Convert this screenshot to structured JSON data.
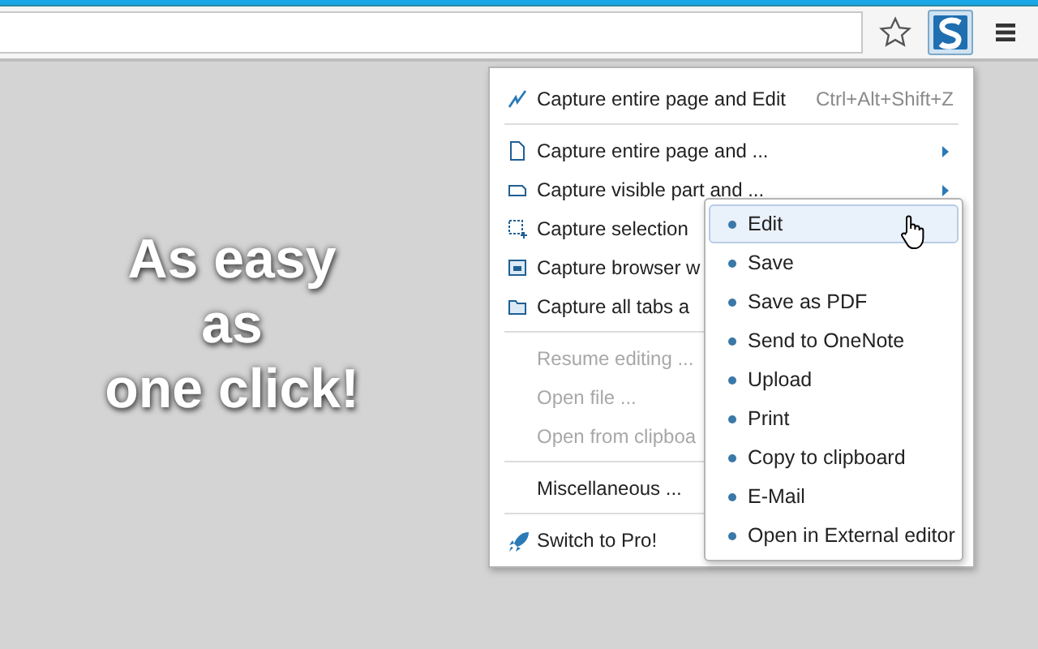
{
  "toolbar": {
    "bookmark_starred": false,
    "extension_active": true
  },
  "headline": {
    "lines": [
      "As easy",
      "as",
      "one click!"
    ]
  },
  "menu": {
    "groups": [
      [
        {
          "kind": "command",
          "label": "Capture entire page and Edit",
          "shortcut": "Ctrl+Alt+Shift+Z",
          "disabled": false
        }
      ],
      [
        {
          "kind": "submenu",
          "label": "Capture entire page and ...",
          "disabled": false
        },
        {
          "kind": "submenu",
          "label": "Capture visible part and ...",
          "disabled": false
        },
        {
          "kind": "command",
          "label": "Capture selection",
          "disabled": false
        },
        {
          "kind": "command",
          "label": "Capture browser w",
          "disabled": false
        },
        {
          "kind": "command",
          "label": "Capture all tabs a",
          "disabled": false
        }
      ],
      [
        {
          "kind": "command",
          "label": "Resume editing ...",
          "disabled": true
        },
        {
          "kind": "command",
          "label": "Open file ...",
          "disabled": true
        },
        {
          "kind": "command",
          "label": "Open from clipboa",
          "disabled": true
        }
      ],
      [
        {
          "kind": "command",
          "label": "Miscellaneous ...",
          "disabled": false
        }
      ],
      [
        {
          "kind": "command",
          "label": "Switch to Pro!",
          "disabled": false
        }
      ]
    ]
  },
  "submenu": {
    "items": [
      {
        "label": "Edit",
        "selected": true
      },
      {
        "label": "Save",
        "selected": false
      },
      {
        "label": "Save as PDF",
        "selected": false
      },
      {
        "label": "Send to OneNote",
        "selected": false
      },
      {
        "label": "Upload",
        "selected": false
      },
      {
        "label": "Print",
        "selected": false
      },
      {
        "label": "Copy to clipboard",
        "selected": false
      },
      {
        "label": "E-Mail",
        "selected": false
      },
      {
        "label": "Open in External editor",
        "selected": false
      }
    ]
  }
}
